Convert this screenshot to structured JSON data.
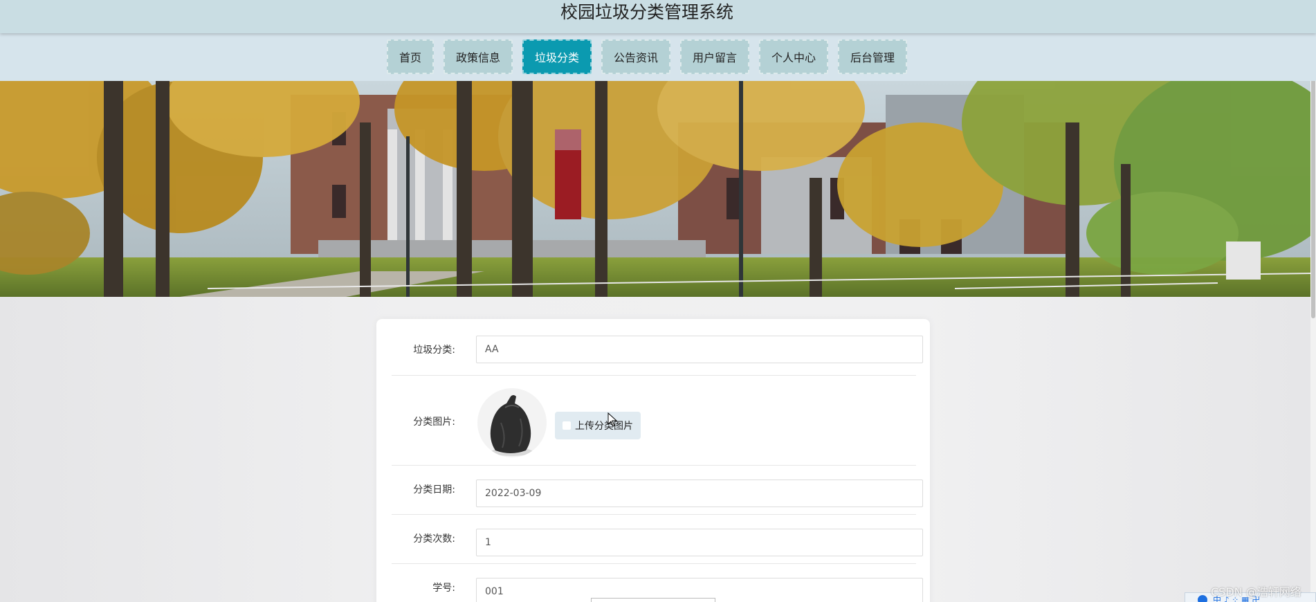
{
  "header": {
    "title": "校园垃圾分类管理系统"
  },
  "nav": {
    "items": [
      {
        "label": "首页",
        "active": false
      },
      {
        "label": "政策信息",
        "active": false
      },
      {
        "label": "垃圾分类",
        "active": true
      },
      {
        "label": "公告资讯",
        "active": false
      },
      {
        "label": "用户留言",
        "active": false
      },
      {
        "label": "个人中心",
        "active": false
      },
      {
        "label": "后台管理",
        "active": false
      }
    ],
    "active_color": "#0b9ab0"
  },
  "form": {
    "category": {
      "label": "垃圾分类:",
      "value": "AA"
    },
    "image": {
      "label": "分类图片:",
      "upload_label": "上传分类图片",
      "preview_icon": "garbage-bag-icon"
    },
    "date": {
      "label": "分类日期:",
      "value": "2022-03-09"
    },
    "count": {
      "label": "分类次数:",
      "value": "1"
    },
    "student_id": {
      "label": "学号:",
      "value": "001"
    }
  },
  "overlay": {
    "watermark": "CSDN @浩轩网络",
    "ime_text": "中 ♪ ⁘ ▦ 卍"
  }
}
